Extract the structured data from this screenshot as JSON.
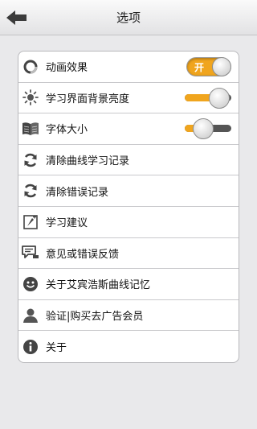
{
  "header": {
    "title": "选项"
  },
  "settings": {
    "items": [
      {
        "label": "动画效果",
        "icon": "loading-ring-icon",
        "control": "toggle",
        "toggle_text": "开"
      },
      {
        "label": "学习界面背景亮度",
        "icon": "sun-icon",
        "control": "slider",
        "level": 0.95
      },
      {
        "label": "字体大小",
        "icon": "book-icon",
        "control": "slider",
        "level": 0.3
      },
      {
        "label": "清除曲线学习记录",
        "icon": "refresh-icon"
      },
      {
        "label": "清除错误记录",
        "icon": "refresh-icon"
      },
      {
        "label": "学习建议",
        "icon": "tips-icon"
      },
      {
        "label": "意见或错误反馈",
        "icon": "feedback-icon"
      },
      {
        "label": "关于艾宾浩斯曲线记忆",
        "icon": "smiley-icon"
      },
      {
        "label": "验证|购买去广告会员",
        "icon": "user-icon"
      },
      {
        "label": "关于",
        "icon": "info-icon"
      }
    ]
  },
  "colors": {
    "accent": "#f0a51e",
    "background": "#e9e9eb"
  }
}
